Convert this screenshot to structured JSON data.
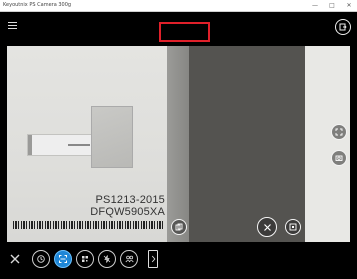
{
  "window": {
    "title": "Keyoutnix PS Camera 300g",
    "minimize_glyph": "—",
    "maximize_glyph": "□",
    "close_glyph": "✕"
  },
  "toolbar": {
    "menu_icon": "hamburger-icon",
    "export_icon": "export-icon",
    "highlight_color": "#e0202a"
  },
  "viewfinder": {
    "serial_line_1": "PS1213-2015",
    "serial_line_2": "DFQW5905XA",
    "side_buttons": [
      "scan-frame-icon",
      "camera-switch-icon"
    ],
    "bottom_left_button": "copy-icon",
    "bottom_right_buttons": [
      "cancel-icon",
      "capture-icon"
    ]
  },
  "bottom_toolbar": {
    "close_icon": "close-icon",
    "modes": [
      {
        "icon": "timer-icon",
        "active": false
      },
      {
        "icon": "scan-icon",
        "active": true
      },
      {
        "icon": "qr-icon",
        "active": false
      },
      {
        "icon": "no-flash-icon",
        "active": false
      },
      {
        "icon": "people-icon",
        "active": false
      }
    ],
    "more_icon": "chevron-right-icon",
    "accent_color": "#1e86d6"
  }
}
